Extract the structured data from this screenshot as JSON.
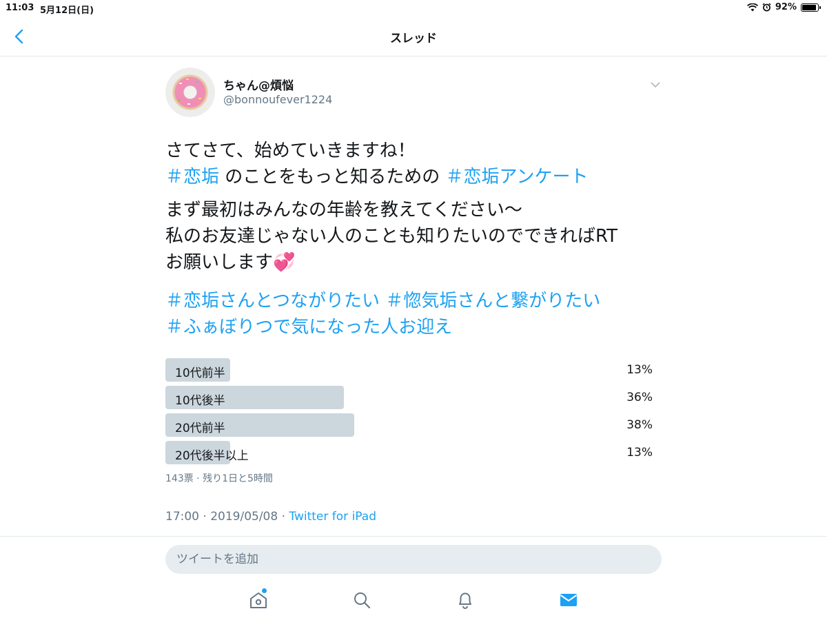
{
  "status_bar": {
    "time": "11:03",
    "date": "5月12日(日)",
    "battery": "92%",
    "battery_level": 0.92
  },
  "nav": {
    "title": "スレッド"
  },
  "tweet": {
    "display_name": "ちゃん@煩悩",
    "handle": "@bonnoufever1224",
    "line1": "さてさて、始めていきますね！",
    "tag1": "＃恋垢",
    "line2_mid": " のことをもっと知るための ",
    "tag2": "＃恋垢アンケート",
    "body1": "まず最初はみんなの年齢を教えてください〜",
    "body2": "私のお友達じゃない人のことも知りたいのでできればRT",
    "body3": "お願いします",
    "body3_emoji": "💞",
    "tag3": "＃恋垢さんとつながりたい",
    "tag4": "＃惚気垢さんと繋がりたい",
    "tag5": "＃ふぁぼりつで気になった人お迎え",
    "timestamp": "17:00 · 2019/05/08 · ",
    "source": "Twitter for iPad"
  },
  "poll": {
    "options": [
      {
        "label": "10代前半",
        "percent_text": "13%",
        "percent": 13
      },
      {
        "label": "10代後半",
        "percent_text": "36%",
        "percent": 36
      },
      {
        "label": "20代前半",
        "percent_text": "38%",
        "percent": 38
      },
      {
        "label": "20代後半以上",
        "percent_text": "13%",
        "percent": 13
      }
    ],
    "meta": "143票 · 残り1日と5時間"
  },
  "reply": {
    "placeholder": "ツイートを追加"
  },
  "colors": {
    "accent": "#1da1f2",
    "poll_bar": "#ccd6dd",
    "muted": "#657786"
  }
}
